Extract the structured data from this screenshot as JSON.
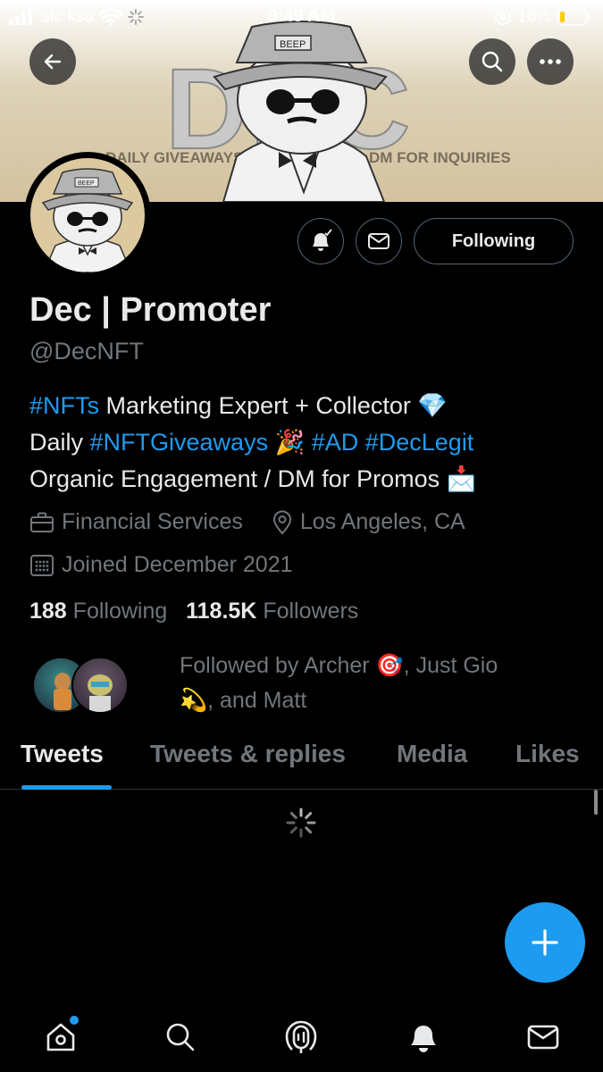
{
  "status_bar": {
    "carrier": "stc ksa",
    "time": "9:49 AM",
    "battery": "16%"
  },
  "banner": {
    "big_text": "DEC",
    "left_text": "DAILY GIVEAWAYS",
    "right_text": "DM FOR INQUIRIES",
    "hat_text": "BEEP"
  },
  "avatar": {
    "hat_text": "BEEP"
  },
  "actions": {
    "following_label": "Following"
  },
  "profile": {
    "name": "Dec | Promoter",
    "handle": "@DecNFT",
    "bio": {
      "l1_tag": "#NFTs",
      "l1_text": " Marketing Expert + Collector ",
      "l1_emoji": "💎",
      "l2_text": "Daily ",
      "l2_tag1": "#NFTGiveaways",
      "l2_emoji": " 🎉 ",
      "l2_tag2": "#AD",
      "l2_tag3": "#DecLegit",
      "l3_text": "Organic Engagement / DM for Promos ",
      "l3_emoji": "📩"
    },
    "category": "Financial Services",
    "location": "Los Angeles, CA",
    "joined": "Joined December 2021",
    "following_count": "188",
    "following_label": "Following",
    "followers_count": "118.5K",
    "followers_label": "Followers",
    "followed_by_l1": "Followed by Archer 🎯, Just Gio",
    "followed_by_l2": "💫, and Matt"
  },
  "tabs": [
    {
      "label": "Tweets",
      "active": true
    },
    {
      "label": "Tweets & replies",
      "active": false
    },
    {
      "label": "Media",
      "active": false
    },
    {
      "label": "Likes",
      "active": false
    }
  ],
  "nav": [
    "home-icon",
    "search-icon",
    "spaces-icon",
    "notifications-icon",
    "messages-icon"
  ],
  "colors": {
    "accent": "#1d9bf0",
    "background": "#000000",
    "secondary_text": "#71767b"
  }
}
